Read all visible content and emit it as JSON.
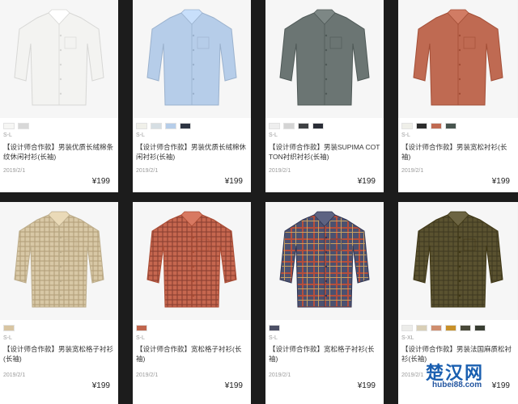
{
  "products": [
    {
      "name": "【设计师合作款】男装优质长绒棉条纹休闲衬衫(长袖)",
      "size": "S-L",
      "date": "2019/2/1",
      "price": "¥199",
      "shirt_color": "#f3f3f1",
      "pattern": "solid",
      "swatches": [
        "#f6f6f4",
        "#d8d8d8"
      ]
    },
    {
      "name": "【设计师合作款】男装优质长绒棉休闲衬衫(长袖)",
      "size": "S-L",
      "date": "2019/2/1",
      "price": "¥199",
      "shirt_color": "#b6cde9",
      "pattern": "solid",
      "swatches": [
        "#f0f0ea",
        "#d6dee3",
        "#b6cde9",
        "#2d3442"
      ]
    },
    {
      "name": "【设计师合作款】男装SUPIMA COTTON衬织衬衫(长袖)",
      "size": "S-L",
      "date": "2019/2/1",
      "price": "¥199",
      "shirt_color": "#6b7573",
      "pattern": "solid",
      "swatches": [
        "#eeeeee",
        "#d4d4d4",
        "#3f4144",
        "#2a2d36"
      ]
    },
    {
      "name": "【设计师合作款】男装宽松衬衫(长袖)",
      "size": "S-L",
      "date": "2019/2/1",
      "price": "¥199",
      "shirt_color": "#bf6a52",
      "pattern": "solid",
      "swatches": [
        "#efefe9",
        "#2d2d2d",
        "#bf6a52",
        "#48554f"
      ]
    },
    {
      "name": "【设计师合作款】男装宽松格子衬衫(长袖)",
      "size": "S-L",
      "date": "2019/2/1",
      "price": "¥199",
      "shirt_color": "#d8c8a6",
      "pattern": "check",
      "check_color": "#b4a07a",
      "swatches": [
        "#d8c5a2"
      ]
    },
    {
      "name": "【设计师合作款】宽松格子衬衫(长袖)",
      "size": "S-L",
      "date": "2019/2/1",
      "price": "¥199",
      "shirt_color": "#c6674f",
      "pattern": "check",
      "check_color": "#8b3f31",
      "swatches": [
        "#c0664e"
      ]
    },
    {
      "name": "【设计师合作款】宽松格子衬衫(长袖)",
      "size": "S-L",
      "date": "2019/2/1",
      "price": "¥199",
      "shirt_color": "#4b5170",
      "pattern": "plaid",
      "check_color": "#b54f3c",
      "swatches": [
        "#4d5066"
      ]
    },
    {
      "name": "【设计师合作款】男装法国麻质松衬衫(长袖)",
      "size": "S-XL",
      "date": "2019/2/1",
      "price": "¥199",
      "shirt_color": "#5a5230",
      "pattern": "check",
      "check_color": "#3f3a20",
      "swatches": [
        "#ececea",
        "#d9cfb7",
        "#cf8e6f",
        "#c8912a",
        "#4a4a3a",
        "#3a3f33"
      ]
    }
  ],
  "watermark": {
    "text": "楚汉网",
    "url": "hubei88.com",
    "color": "#1a5fb0"
  }
}
